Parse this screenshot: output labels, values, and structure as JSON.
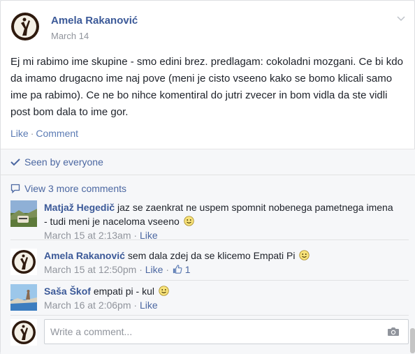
{
  "post": {
    "author": "Amela Rakanović",
    "date": "March 14",
    "text": "Ej mi rabimo ime skupine - smo edini brez. predlagam: cokoladni mozgani. Ce bi kdo da imamo drugacno ime naj pove (meni je cisto vseeno kako se bomo klicali samo ime pa rabimo). Ce ne bo nihce komentiral do jutri zvecer in bom vidla da ste vidli post bom dala to ime gor.",
    "like_label": "Like",
    "comment_label": "Comment",
    "separator": "·"
  },
  "ufi": {
    "seen_label": "Seen by everyone",
    "more_comments_label": "View 3 more comments",
    "write_placeholder": "Write a comment..."
  },
  "comments": [
    {
      "author": "Matjaž Hegedič",
      "text": "jaz se zaenkrat ne uspem spomnit nobenega pametnega imena - tudi meni je naceloma vseeno",
      "time": "March 15 at 2:13am",
      "like_label": "Like",
      "separator": "·"
    },
    {
      "author": "Amela Rakanović",
      "text": "sem dala zdej da se klicemo Empati Pi",
      "time": "March 15 at 12:50pm",
      "like_label": "Like",
      "separator": "·",
      "like_count": "1"
    },
    {
      "author": "Saša Škof",
      "text": "empati pi - kul",
      "time": "March 16 at 2:06pm",
      "like_label": "Like",
      "separator": "·"
    }
  ],
  "icons": {
    "chevron": "chevron-down-icon",
    "seen": "checkmark-icon",
    "more": "speech-bubble-icon",
    "emoji": "smiley-emoji-icon",
    "thumb": "thumbs-up-icon",
    "camera": "camera-icon"
  },
  "colors": {
    "link": "#3b5998",
    "muted": "#90949c",
    "ufi_bg": "#f6f7f9"
  }
}
